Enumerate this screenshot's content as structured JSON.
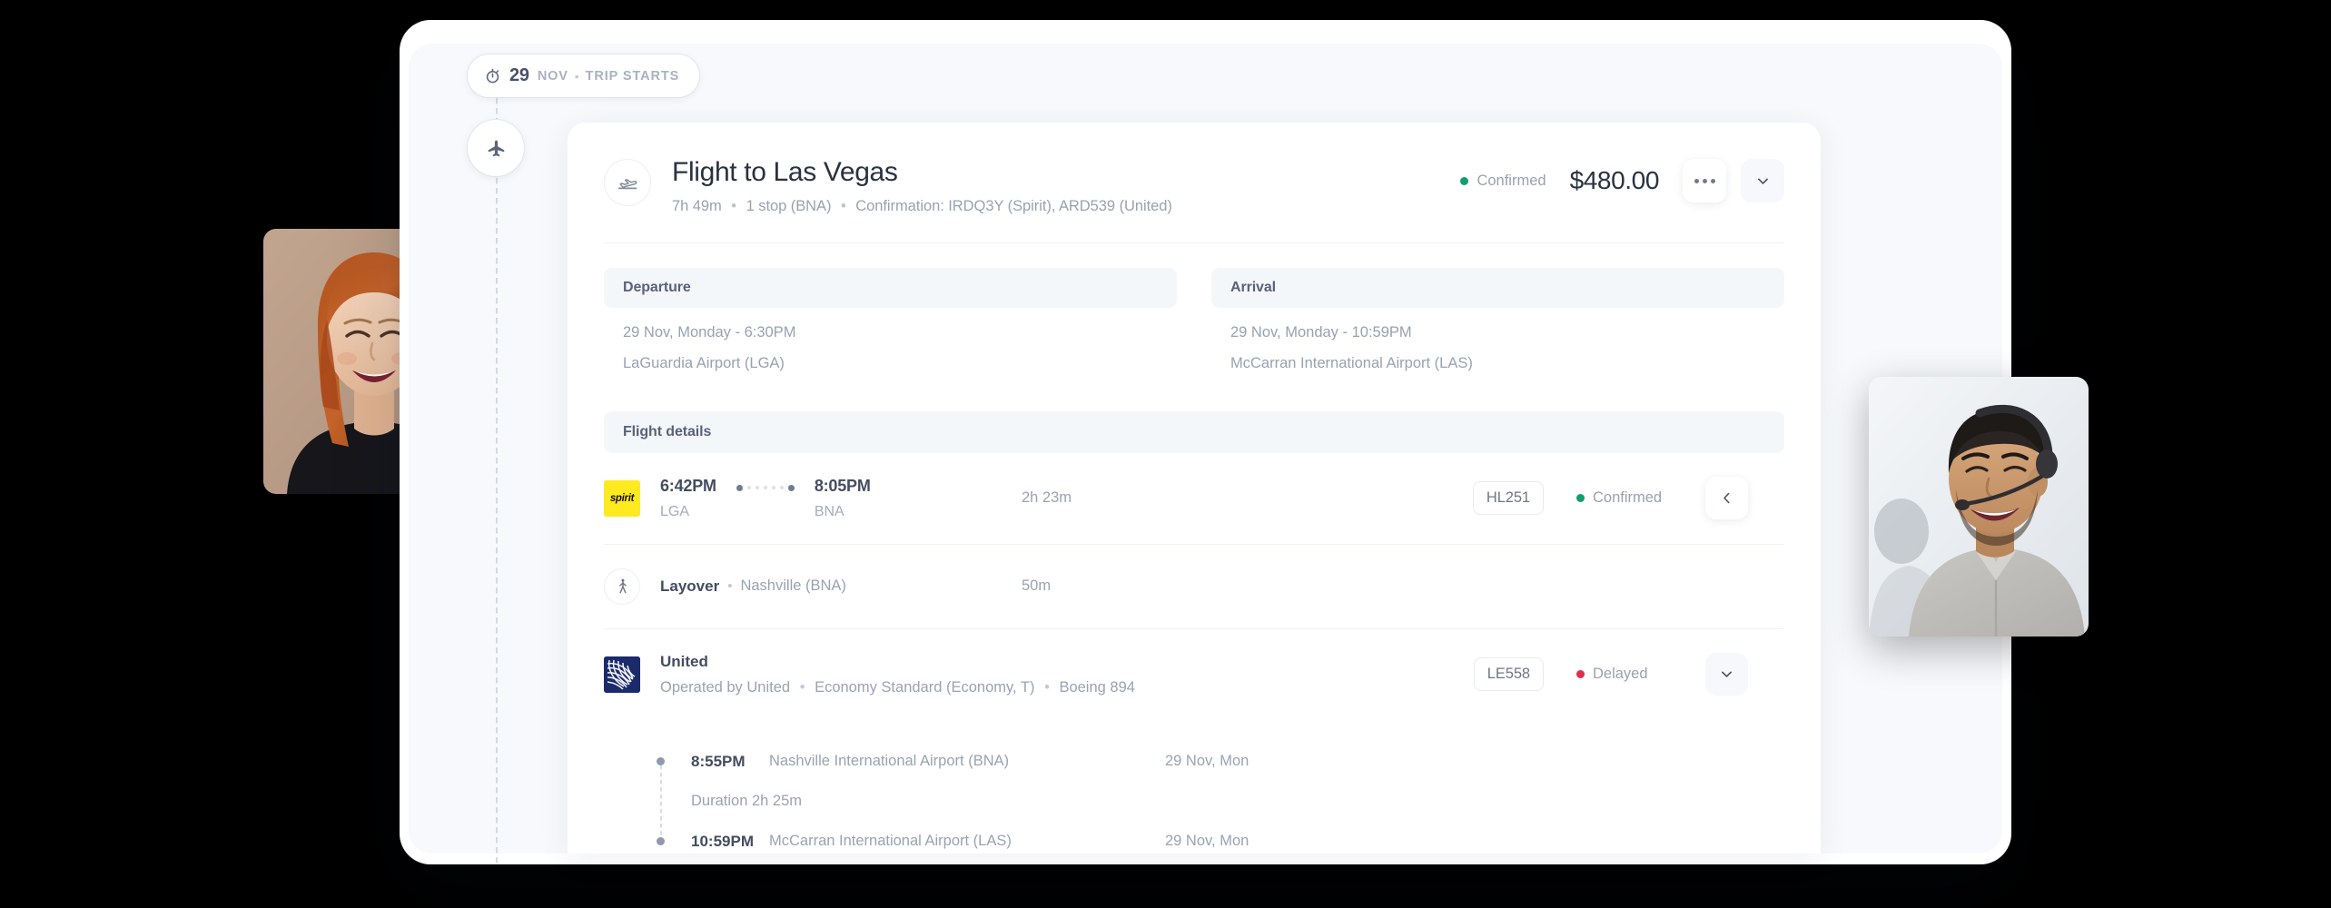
{
  "trip_pill": {
    "icon": "stopwatch-icon",
    "day": "29",
    "month": "NOV",
    "separator": "•",
    "tag": "TRIP STARTS"
  },
  "rail_node_icon": "airplane-icon",
  "flight_card": {
    "header": {
      "icon": "airplane-takeoff-icon",
      "title": "Flight to Las Vegas",
      "subtitle_parts": {
        "duration": "7h 49m",
        "stops": "1 stop (BNA)",
        "confirmation": "Confirmation: IRDQ3Y (Spirit), ARD539 (United)"
      },
      "status": "Confirmed",
      "status_color": "#0e9f6e",
      "price": "$480.00",
      "more_button": "more-options-icon",
      "collapse_button": "chevron-down-icon"
    },
    "departure": {
      "heading": "Departure",
      "datetime": "29 Nov, Monday - 6:30PM",
      "airport": "LaGuardia Airport (LGA)"
    },
    "arrival": {
      "heading": "Arrival",
      "datetime": "29 Nov, Monday - 10:59PM",
      "airport": "McCarran International Airport (LAS)"
    },
    "flight_details_heading": "Flight details",
    "segments": [
      {
        "airline_logo": "spirit-logo",
        "airline_logo_text": "spirit",
        "logo_bg": "#ffe91f",
        "depart_time": "6:42PM",
        "depart_code": "LGA",
        "arrive_time": "8:05PM",
        "arrive_code": "BNA",
        "duration": "2h 23m",
        "flight_code": "HL251",
        "status": "Confirmed",
        "status_color": "#0e9f6e",
        "action_icon": "chevron-left-icon"
      }
    ],
    "layover": {
      "icon": "layover-walk-icon",
      "label": "Layover",
      "separator": "•",
      "city": "Nashville (BNA)",
      "duration": "50m"
    },
    "united_segment": {
      "airline_logo": "united-logo",
      "logo_bg": "#1b2a6b",
      "name": "United",
      "sub_parts": {
        "operated": "Operated by United",
        "cabin": "Economy Standard (Economy, T)",
        "aircraft": "Boeing 894"
      },
      "flight_code": "LE558",
      "status": "Delayed",
      "status_color": "#e02d4b",
      "action_icon": "chevron-down-icon"
    },
    "timeline": [
      {
        "type": "stop",
        "time": "8:55PM",
        "place": "Nashville International Airport (BNA)",
        "date": "29 Nov, Mon"
      },
      {
        "type": "duration",
        "label": "Duration 2h 25m"
      },
      {
        "type": "stop",
        "time": "10:59PM",
        "place": "McCarran International Airport (LAS)",
        "date": "29 Nov, Mon"
      }
    ]
  },
  "photos": {
    "left": {
      "alt": "smiling-woman-portrait"
    },
    "right": {
      "alt": "smiling-support-agent-with-headset"
    }
  }
}
